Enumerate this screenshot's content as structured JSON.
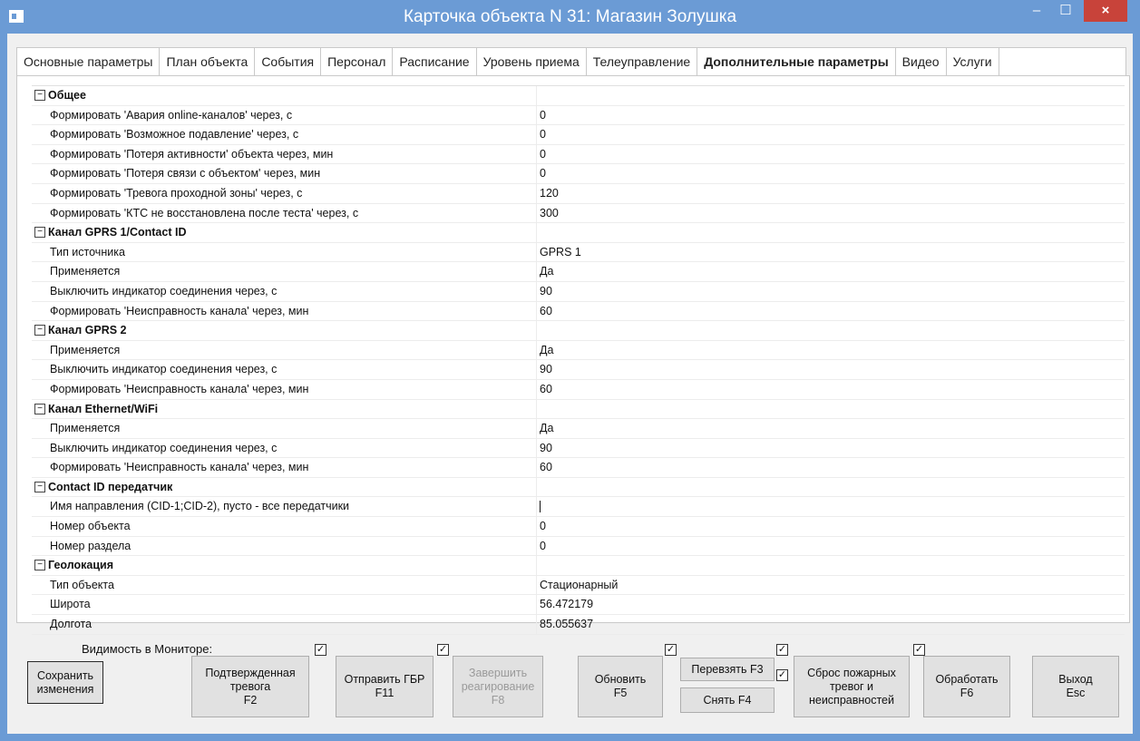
{
  "window": {
    "title": "Карточка объекта N 31: Магазин Золушка",
    "min_glyph": "–",
    "max_glyph": "☐",
    "close_glyph": "×"
  },
  "tabs": [
    {
      "label": "Основные параметры"
    },
    {
      "label": "План объекта"
    },
    {
      "label": "События"
    },
    {
      "label": "Персонал"
    },
    {
      "label": "Расписание"
    },
    {
      "label": "Уровень приема"
    },
    {
      "label": "Телеуправление"
    },
    {
      "label": "Дополнительные параметры",
      "active": true
    },
    {
      "label": "Видео"
    },
    {
      "label": "Услуги"
    }
  ],
  "categories": [
    {
      "name": "Общее",
      "expander": "⊟",
      "items": [
        {
          "key": "Формировать 'Авария online-каналов' через, с",
          "value": "0"
        },
        {
          "key": "Формировать 'Возможное подавление' через, с",
          "value": "0"
        },
        {
          "key": "Формировать 'Потеря активности' объекта через, мин",
          "value": "0"
        },
        {
          "key": "Формировать 'Потеря связи с объектом' через, мин",
          "value": "0"
        },
        {
          "key": "Формировать 'Тревога проходной зоны' через, с",
          "value": "120"
        },
        {
          "key": "Формировать 'КТС не восстановлена после теста' через, с",
          "value": "300"
        }
      ]
    },
    {
      "name": "Канал GPRS 1/Contact ID",
      "expander": "⊟",
      "items": [
        {
          "key": "Тип источника",
          "value": "GPRS 1"
        },
        {
          "key": "Применяется",
          "value": "Да"
        },
        {
          "key": "Выключить индикатор соединения через, с",
          "value": "90"
        },
        {
          "key": "Формировать 'Неисправность канала' через, мин",
          "value": "60"
        }
      ]
    },
    {
      "name": "Канал GPRS 2",
      "expander": "⊟",
      "items": [
        {
          "key": "Применяется",
          "value": "Да"
        },
        {
          "key": "Выключить индикатор соединения через, с",
          "value": "90"
        },
        {
          "key": "Формировать 'Неисправность канала' через, мин",
          "value": "60"
        }
      ]
    },
    {
      "name": "Канал Ethernet/WiFi",
      "expander": "⊟",
      "items": [
        {
          "key": "Применяется",
          "value": "Да"
        },
        {
          "key": "Выключить индикатор соединения через, с",
          "value": "90"
        },
        {
          "key": "Формировать 'Неисправность канала' через, мин",
          "value": "60"
        }
      ]
    },
    {
      "name": "Contact ID передатчик",
      "expander": "⊟",
      "items": [
        {
          "key": "Имя направления (CID-1;CID-2), пусто - все передатчики",
          "value": "",
          "editing": true
        },
        {
          "key": "Номер объекта",
          "value": "0"
        },
        {
          "key": "Номер раздела",
          "value": "0"
        }
      ]
    },
    {
      "name": "Геолокация",
      "expander": "⊟",
      "items": [
        {
          "key": "Тип объекта",
          "value": "Стационарный"
        },
        {
          "key": "Широта",
          "value": "56.472179"
        },
        {
          "key": "Долгота",
          "value": "85.055637"
        }
      ]
    }
  ],
  "footer": {
    "visibility_label": "Видимость в Мониторе:",
    "check_glyph": "✓",
    "buttons": {
      "save": "Сохранить\nизменения",
      "confirmed_alarm": "Подтвержденная\nтревога\nF2",
      "send_gbr": "Отправить ГБР\nF11",
      "finish_response": "Завершить\nреагирование\nF8",
      "refresh": "Обновить\nF5",
      "rearm": "Перевзять F3",
      "disarm": "Снять F4",
      "reset_fire": "Сброс пожарных\nтревог и\nнеисправностей",
      "process": "Обработать\nF6",
      "exit": "Выход\nEsc"
    }
  }
}
